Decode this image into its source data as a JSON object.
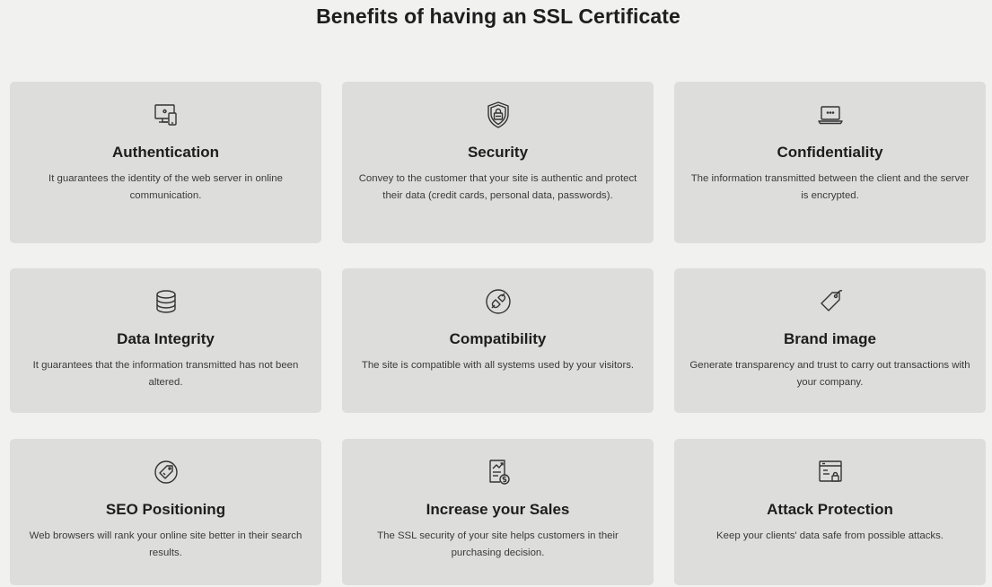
{
  "page": {
    "title": "Benefits of having an SSL Certificate"
  },
  "cards": [
    {
      "title": "Authentication",
      "text": "It guarantees the identity of the web server in online communication.",
      "icon": "devices-icon"
    },
    {
      "title": "Security",
      "text": "Convey to the customer that your site is authentic and protect their data (credit cards, personal data, passwords).",
      "icon": "shield-lock-icon"
    },
    {
      "title": "Confidentiality",
      "text": "The information transmitted between the client and the server is encrypted.",
      "icon": "laptop-password-icon"
    },
    {
      "title": "Data Integrity",
      "text": "It guarantees that the information transmitted has not been altered.",
      "icon": "database-icon"
    },
    {
      "title": "Compatibility",
      "text": "The site is compatible with all systems used by your visitors.",
      "icon": "plug-icon"
    },
    {
      "title": "Brand image",
      "text": "Generate transparency and trust to carry out transactions with your company.",
      "icon": "tag-icon"
    },
    {
      "title": "SEO Positioning",
      "text": "Web browsers will rank your online site better in their search results.",
      "icon": "badge-tag-icon"
    },
    {
      "title": "Increase your Sales",
      "text": "The SSL security of your site helps customers in their purchasing decision.",
      "icon": "sales-report-icon"
    },
    {
      "title": "Attack Protection",
      "text": "Keep your clients' data safe from possible attacks.",
      "icon": "browser-lock-icon"
    }
  ],
  "colors": {
    "background": "#f1f1f0",
    "card": "#dddddc",
    "heading": "#1e1e1e",
    "text": "#3a3a3a"
  }
}
